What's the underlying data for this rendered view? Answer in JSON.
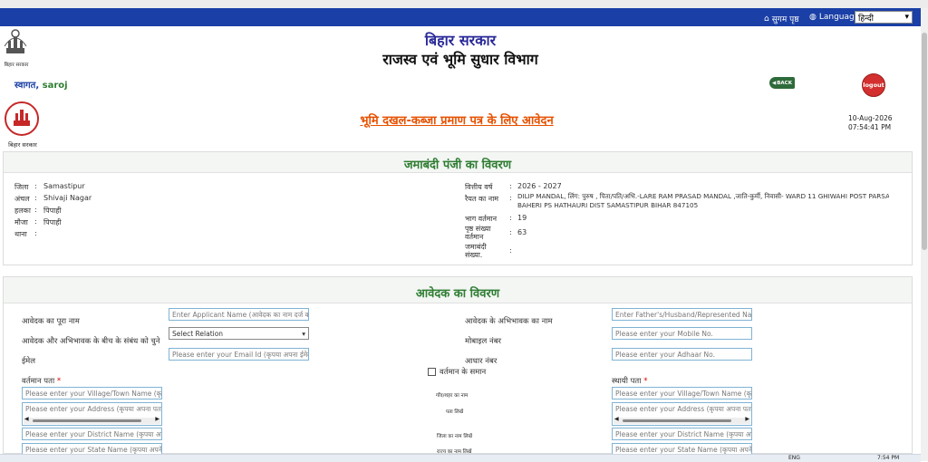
{
  "topbar": {
    "sitemap": "सुगम पृष्ठ",
    "language_label": "Language:",
    "language_value": "हिन्दी"
  },
  "header": {
    "org_line1": "बिहार सरकार",
    "org_line2": "राजस्व एवं भूमि सुधार विभाग",
    "emblem_caption": "बिहार सरकार",
    "welcome_prefix": "स्वागत,",
    "user_name": "saroj",
    "back_label": "BACK",
    "logout_label": "logout"
  },
  "form_title": "भूमि दखल-कब्जा प्रमाण पत्र के लिए आवेदन",
  "form_emblem_caption": "बिहार सरकार",
  "datetime": {
    "date": "10-Aug-2026",
    "time": "07:54:41 PM"
  },
  "jamabandi": {
    "title": "जमाबंदी पंजी का विवरण",
    "left": [
      {
        "label": "जिला",
        "value": "Samastipur"
      },
      {
        "label": "अंचल",
        "value": "Shivaji Nagar"
      },
      {
        "label": "हलका",
        "value": "पिपाही"
      },
      {
        "label": "मौजा",
        "value": "पिपाही"
      },
      {
        "label": "थाना",
        "value": ""
      }
    ],
    "right": {
      "fy_label": "वित्तीय वर्ष",
      "fy_value": "2026 - 2027",
      "raiyat_label": "रैयत का नाम",
      "raiyat_value_1": "DILIP MANDAL, लिंग: पुरुष , पिता/पति/अभि.-LARE RAM PRASAD MANDAL ,जाति-कुर्मी, निवासी- WARD 11 GHIWAHI POST PARSA VIA",
      "raiyat_value_2": "BAHERI PS HATHAURI DIST SAMASTIPUR BIHAR 847105",
      "bhag_label": "भाग वर्तमान",
      "bhag_value": "19",
      "page_label_1": "पृष्ठ संख्या",
      "page_label_2": "वर्तमान",
      "page_value": "63",
      "jamabandi_label_1": "जमाबंदी",
      "jamabandi_label_2": "संख्या.",
      "jamabandi_value": ""
    }
  },
  "applicant": {
    "title": "आवेदक का विवरण",
    "name_label": "आवेदक का पूरा नाम",
    "name_placeholder": "Enter Applicant Name (आवेदक का नाम दर्ज करें)",
    "guardian_label": "आवेदक के अभिभावक का नाम",
    "guardian_placeholder": "Enter Father's/Husband/Represented Name (पिता/पति का नाम)",
    "relation_label": "आवेदक और अभिभावक के बीच के संबंध को चुने",
    "relation_value": "Select Relation",
    "mobile_label": "मोबाइल नंबर",
    "mobile_placeholder": "Please enter your Mobile No.",
    "email_label": "ईमेल",
    "email_placeholder": "Please enter your Email Id (कृपया अपना ईमेल दर्ज करें)",
    "aadhaar_label": "आधार नंबर",
    "aadhaar_placeholder": "Please enter your Adhaar No.",
    "same_as_current": "वर्तमान के समान",
    "current_address_label": "वर्तमान पता",
    "permanent_address_label": "स्थायी पता",
    "required_mark": "*",
    "mid_village": "गाँव/शहर का नाम",
    "mid_address": "पता लिखें",
    "mid_district": "जिला का नाम लिखें",
    "mid_state": "राज्य का नाम लिखें",
    "village_placeholder": "Please enter your Village/Town Name (कृपया अपना गाँव/शहर का नाम)",
    "address_placeholder": "Please enter your Address (कृपया अपना पता दर्ज करें)",
    "district_placeholder": "Please enter your District Name (कृपया अपने जिले का नाम)",
    "state_placeholder": "Please enter your State Name (कृपया अपने राज्य का नाम)"
  },
  "taskbar": {
    "lang": "ENG",
    "time": "7:54 PM"
  },
  "colors": {
    "blue_bar": "#1a3fa6",
    "title_orange": "#e65100",
    "section_green": "#2e7d32",
    "user_green": "#2e7d32",
    "logout_red": "#d32f2f"
  }
}
